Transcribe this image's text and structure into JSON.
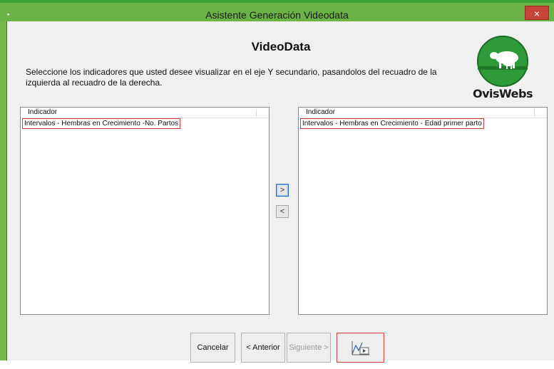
{
  "window": {
    "title": "Asistente Generación Videodata",
    "close_glyph": "×",
    "app_icon": "app-icon"
  },
  "header": {
    "title": "VideoData",
    "instructions": "Seleccione los indicadores que usted desee visualizar en el eje Y secundario, pasandolos del recuadro de la izquierda al recuadro de la derecha.",
    "logo_text": "OvisWebs"
  },
  "left_list": {
    "column_header": "Indicador",
    "items": [
      "Intervalos - Hembras en Crecimiento -No. Partos"
    ]
  },
  "right_list": {
    "column_header": "Indicador",
    "items": [
      "Intervalos - Hembras en Crecimiento - Edad primer parto"
    ]
  },
  "move_buttons": {
    "right": ">",
    "left": "<"
  },
  "footer": {
    "cancel": "Cancelar",
    "previous": "< Anterior",
    "next": "Siguiente >",
    "video_icon": "chart-play-icon"
  },
  "colors": {
    "title_bar": "#6bb344",
    "close_button": "#c7443a",
    "highlight": "#d63a3a"
  }
}
